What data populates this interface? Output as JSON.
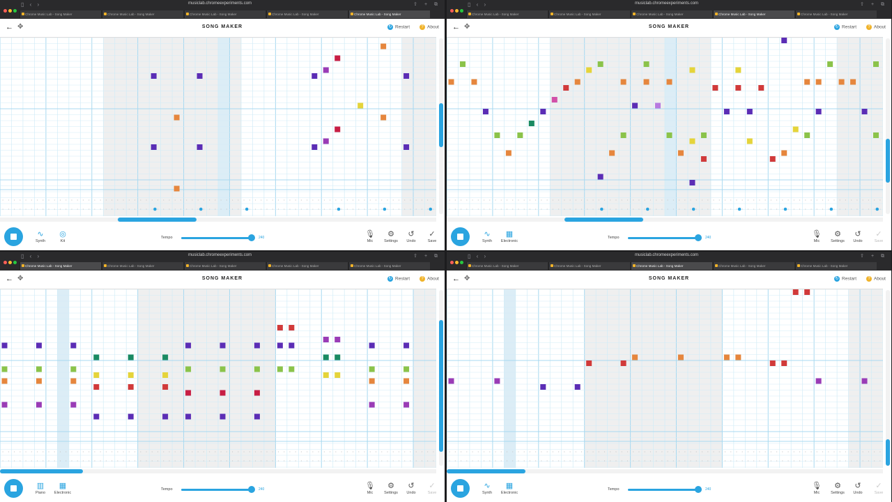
{
  "browser": {
    "url": "musiclab.chromeexperiments.com",
    "tab_title": "Chrome Music Lab - Song Maker",
    "tab_count": 5
  },
  "app": {
    "title": "SONG MAKER",
    "restart_label": "Restart",
    "about_label": "About",
    "tempo_label": "Tempo",
    "tempo_value": "240",
    "mic_label": "Mic",
    "settings_label": "Settings",
    "undo_label": "Undo",
    "save_label": "Save"
  },
  "colors": {
    "accent": "#2aa4e0",
    "purple": "#5b2db5",
    "orange": "#e6863d",
    "green": "#8bc34a",
    "red": "#d13a3a",
    "crimson": "#c81e44",
    "magenta": "#9a3cb6",
    "yellow": "#e5d43a",
    "teal": "#1a8a62",
    "pink": "#d24fa8",
    "lavender": "#b87ae0",
    "grid_line": "#d2ecf7",
    "grid_bar": "#a8d9f0",
    "shade": "#efefef"
  },
  "panes": [
    {
      "active_tab": 4,
      "instrument": {
        "label": "Synth",
        "icon": "synth-wave-icon"
      },
      "rhythm": {
        "label": "Kit",
        "icon": "drum-kit-icon"
      },
      "hscroll": {
        "start": 0.27,
        "size": 0.18
      },
      "vscroll": {
        "start": 0.37,
        "size": 0.25
      },
      "shade_cols": [
        9,
        10,
        11,
        12,
        13,
        14,
        15,
        16,
        17,
        18,
        19,
        20,
        35,
        36,
        37
      ],
      "highlight_cols": [
        19
      ],
      "percussion_cols": [
        13,
        17,
        21,
        29,
        33,
        37
      ],
      "notes": [
        {
          "c": 33,
          "r": 1,
          "col": "orange"
        },
        {
          "c": 29,
          "r": 3,
          "col": "crimson"
        },
        {
          "c": 28,
          "r": 5,
          "col": "magenta"
        },
        {
          "c": 13,
          "r": 6,
          "col": "purple"
        },
        {
          "c": 17,
          "r": 6,
          "col": "purple"
        },
        {
          "c": 27,
          "r": 6,
          "col": "purple"
        },
        {
          "c": 35,
          "r": 6,
          "col": "purple"
        },
        {
          "c": 31,
          "r": 11,
          "col": "yellow"
        },
        {
          "c": 15,
          "r": 13,
          "col": "orange"
        },
        {
          "c": 33,
          "r": 13,
          "col": "orange"
        },
        {
          "c": 29,
          "r": 15,
          "col": "crimson"
        },
        {
          "c": 28,
          "r": 17,
          "col": "magenta"
        },
        {
          "c": 13,
          "r": 18,
          "col": "purple"
        },
        {
          "c": 17,
          "r": 18,
          "col": "purple"
        },
        {
          "c": 27,
          "r": 18,
          "col": "purple"
        },
        {
          "c": 35,
          "r": 18,
          "col": "purple"
        },
        {
          "c": 15,
          "r": 25,
          "col": "orange"
        }
      ]
    },
    {
      "active_tab": 3,
      "instrument": {
        "label": "Synth",
        "icon": "synth-wave-icon"
      },
      "rhythm": {
        "label": "Electronic",
        "icon": "electronic-pad-icon"
      },
      "hscroll": {
        "start": 0.27,
        "size": 0.18
      },
      "vscroll": {
        "start": 0.57,
        "size": 0.25
      },
      "shade_cols": [
        9,
        10,
        11,
        12,
        13,
        14,
        15,
        16,
        17,
        18,
        19,
        20,
        21,
        22,
        34,
        35,
        36,
        37
      ],
      "highlight_cols": [
        19
      ],
      "percussion_cols": [
        13,
        17,
        21,
        25,
        29,
        33,
        37
      ],
      "notes": [
        {
          "c": 29,
          "r": 0,
          "col": "purple"
        },
        {
          "c": 1,
          "r": 4,
          "col": "green"
        },
        {
          "c": 13,
          "r": 4,
          "col": "green"
        },
        {
          "c": 17,
          "r": 4,
          "col": "green"
        },
        {
          "c": 33,
          "r": 4,
          "col": "green"
        },
        {
          "c": 37,
          "r": 4,
          "col": "green"
        },
        {
          "c": 12,
          "r": 5,
          "col": "yellow"
        },
        {
          "c": 21,
          "r": 5,
          "col": "yellow"
        },
        {
          "c": 25,
          "r": 5,
          "col": "yellow"
        },
        {
          "c": 0,
          "r": 7,
          "col": "orange"
        },
        {
          "c": 2,
          "r": 7,
          "col": "orange"
        },
        {
          "c": 11,
          "r": 7,
          "col": "orange"
        },
        {
          "c": 15,
          "r": 7,
          "col": "orange"
        },
        {
          "c": 17,
          "r": 7,
          "col": "orange"
        },
        {
          "c": 19,
          "r": 7,
          "col": "orange"
        },
        {
          "c": 31,
          "r": 7,
          "col": "orange"
        },
        {
          "c": 32,
          "r": 7,
          "col": "orange"
        },
        {
          "c": 34,
          "r": 7,
          "col": "orange"
        },
        {
          "c": 35,
          "r": 7,
          "col": "orange"
        },
        {
          "c": 10,
          "r": 8,
          "col": "red"
        },
        {
          "c": 23,
          "r": 8,
          "col": "red"
        },
        {
          "c": 25,
          "r": 8,
          "col": "red"
        },
        {
          "c": 27,
          "r": 8,
          "col": "red"
        },
        {
          "c": 9,
          "r": 10,
          "col": "pink"
        },
        {
          "c": 16,
          "r": 11,
          "col": "purple"
        },
        {
          "c": 18,
          "r": 11,
          "col": "lavender"
        },
        {
          "c": 3,
          "r": 12,
          "col": "purple"
        },
        {
          "c": 8,
          "r": 12,
          "col": "purple"
        },
        {
          "c": 24,
          "r": 12,
          "col": "purple"
        },
        {
          "c": 26,
          "r": 12,
          "col": "purple"
        },
        {
          "c": 32,
          "r": 12,
          "col": "purple"
        },
        {
          "c": 36,
          "r": 12,
          "col": "purple"
        },
        {
          "c": 7,
          "r": 14,
          "col": "teal"
        },
        {
          "c": 30,
          "r": 15,
          "col": "yellow"
        },
        {
          "c": 4,
          "r": 16,
          "col": "green"
        },
        {
          "c": 6,
          "r": 16,
          "col": "green"
        },
        {
          "c": 15,
          "r": 16,
          "col": "green"
        },
        {
          "c": 19,
          "r": 16,
          "col": "green"
        },
        {
          "c": 22,
          "r": 16,
          "col": "green"
        },
        {
          "c": 31,
          "r": 16,
          "col": "green"
        },
        {
          "c": 37,
          "r": 16,
          "col": "green"
        },
        {
          "c": 21,
          "r": 17,
          "col": "yellow"
        },
        {
          "c": 26,
          "r": 17,
          "col": "yellow"
        },
        {
          "c": 5,
          "r": 19,
          "col": "orange"
        },
        {
          "c": 14,
          "r": 19,
          "col": "orange"
        },
        {
          "c": 20,
          "r": 19,
          "col": "orange"
        },
        {
          "c": 29,
          "r": 19,
          "col": "orange"
        },
        {
          "c": 22,
          "r": 20,
          "col": "red"
        },
        {
          "c": 28,
          "r": 20,
          "col": "red"
        },
        {
          "c": 13,
          "r": 23,
          "col": "purple"
        },
        {
          "c": 21,
          "r": 24,
          "col": "purple"
        }
      ]
    },
    {
      "active_tab": 0,
      "instrument": {
        "label": "Piano",
        "icon": "piano-icon"
      },
      "rhythm": {
        "label": "Electronic",
        "icon": "electronic-pad-icon"
      },
      "hscroll": {
        "start": 0.0,
        "size": 0.19
      },
      "vscroll": {
        "start": 0.17,
        "size": 0.75
      },
      "shade_cols": [
        12,
        13,
        14,
        15,
        16,
        17,
        18,
        19,
        20,
        21,
        22,
        23,
        36,
        37
      ],
      "highlight_cols": [
        5
      ],
      "percussion_cols": [],
      "notes": [
        {
          "c": 24,
          "r": 6,
          "col": "red"
        },
        {
          "c": 25,
          "r": 6,
          "col": "red"
        },
        {
          "c": 28,
          "r": 8,
          "col": "magenta"
        },
        {
          "c": 29,
          "r": 8,
          "col": "magenta"
        },
        {
          "c": 0,
          "r": 9,
          "col": "purple"
        },
        {
          "c": 3,
          "r": 9,
          "col": "purple"
        },
        {
          "c": 6,
          "r": 9,
          "col": "purple"
        },
        {
          "c": 16,
          "r": 9,
          "col": "purple"
        },
        {
          "c": 19,
          "r": 9,
          "col": "purple"
        },
        {
          "c": 22,
          "r": 9,
          "col": "purple"
        },
        {
          "c": 24,
          "r": 9,
          "col": "purple"
        },
        {
          "c": 25,
          "r": 9,
          "col": "purple"
        },
        {
          "c": 32,
          "r": 9,
          "col": "purple"
        },
        {
          "c": 35,
          "r": 9,
          "col": "purple"
        },
        {
          "c": 8,
          "r": 11,
          "col": "teal"
        },
        {
          "c": 11,
          "r": 11,
          "col": "teal"
        },
        {
          "c": 14,
          "r": 11,
          "col": "teal"
        },
        {
          "c": 28,
          "r": 11,
          "col": "teal"
        },
        {
          "c": 29,
          "r": 11,
          "col": "teal"
        },
        {
          "c": 0,
          "r": 13,
          "col": "green"
        },
        {
          "c": 3,
          "r": 13,
          "col": "green"
        },
        {
          "c": 6,
          "r": 13,
          "col": "green"
        },
        {
          "c": 16,
          "r": 13,
          "col": "green"
        },
        {
          "c": 19,
          "r": 13,
          "col": "green"
        },
        {
          "c": 22,
          "r": 13,
          "col": "green"
        },
        {
          "c": 24,
          "r": 13,
          "col": "green"
        },
        {
          "c": 25,
          "r": 13,
          "col": "green"
        },
        {
          "c": 32,
          "r": 13,
          "col": "green"
        },
        {
          "c": 35,
          "r": 13,
          "col": "green"
        },
        {
          "c": 8,
          "r": 14,
          "col": "yellow"
        },
        {
          "c": 11,
          "r": 14,
          "col": "yellow"
        },
        {
          "c": 14,
          "r": 14,
          "col": "yellow"
        },
        {
          "c": 28,
          "r": 14,
          "col": "yellow"
        },
        {
          "c": 29,
          "r": 14,
          "col": "yellow"
        },
        {
          "c": 0,
          "r": 15,
          "col": "orange"
        },
        {
          "c": 3,
          "r": 15,
          "col": "orange"
        },
        {
          "c": 6,
          "r": 15,
          "col": "orange"
        },
        {
          "c": 32,
          "r": 15,
          "col": "orange"
        },
        {
          "c": 35,
          "r": 15,
          "col": "orange"
        },
        {
          "c": 8,
          "r": 16,
          "col": "red"
        },
        {
          "c": 11,
          "r": 16,
          "col": "red"
        },
        {
          "c": 14,
          "r": 16,
          "col": "red"
        },
        {
          "c": 16,
          "r": 17,
          "col": "crimson"
        },
        {
          "c": 19,
          "r": 17,
          "col": "crimson"
        },
        {
          "c": 22,
          "r": 17,
          "col": "crimson"
        },
        {
          "c": 0,
          "r": 19,
          "col": "magenta"
        },
        {
          "c": 3,
          "r": 19,
          "col": "magenta"
        },
        {
          "c": 6,
          "r": 19,
          "col": "magenta"
        },
        {
          "c": 32,
          "r": 19,
          "col": "magenta"
        },
        {
          "c": 35,
          "r": 19,
          "col": "magenta"
        },
        {
          "c": 8,
          "r": 21,
          "col": "purple"
        },
        {
          "c": 11,
          "r": 21,
          "col": "purple"
        },
        {
          "c": 14,
          "r": 21,
          "col": "purple"
        },
        {
          "c": 16,
          "r": 21,
          "col": "purple"
        },
        {
          "c": 19,
          "r": 21,
          "col": "purple"
        },
        {
          "c": 22,
          "r": 21,
          "col": "purple"
        }
      ]
    },
    {
      "active_tab": 2,
      "instrument": {
        "label": "Synth",
        "icon": "synth-wave-icon"
      },
      "rhythm": {
        "label": "Electronic",
        "icon": "electronic-pad-icon"
      },
      "hscroll": {
        "start": 0.0,
        "size": 0.18
      },
      "vscroll": {
        "start": 0.85,
        "size": 0.15
      },
      "shade_cols": [
        12,
        13,
        14,
        15,
        16,
        17,
        18,
        19,
        20,
        21,
        22,
        23,
        35,
        36,
        37
      ],
      "highlight_cols": [
        5
      ],
      "percussion_cols": [],
      "notes": [
        {
          "c": 30,
          "r": 0,
          "col": "red"
        },
        {
          "c": 31,
          "r": 0,
          "col": "red"
        },
        {
          "c": 12,
          "r": 12,
          "col": "red"
        },
        {
          "c": 15,
          "r": 12,
          "col": "red"
        },
        {
          "c": 28,
          "r": 12,
          "col": "red"
        },
        {
          "c": 29,
          "r": 12,
          "col": "red"
        },
        {
          "c": 16,
          "r": 11,
          "col": "orange"
        },
        {
          "c": 20,
          "r": 11,
          "col": "orange"
        },
        {
          "c": 24,
          "r": 11,
          "col": "orange"
        },
        {
          "c": 25,
          "r": 11,
          "col": "orange"
        },
        {
          "c": 0,
          "r": 15,
          "col": "magenta"
        },
        {
          "c": 4,
          "r": 15,
          "col": "magenta"
        },
        {
          "c": 32,
          "r": 15,
          "col": "magenta"
        },
        {
          "c": 36,
          "r": 15,
          "col": "magenta"
        },
        {
          "c": 8,
          "r": 16,
          "col": "purple"
        },
        {
          "c": 11,
          "r": 16,
          "col": "purple"
        }
      ]
    }
  ]
}
